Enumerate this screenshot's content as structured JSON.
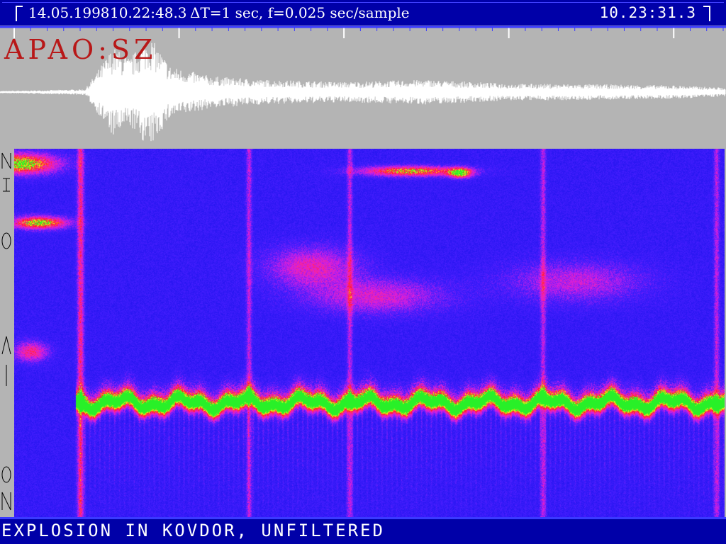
{
  "header": {
    "date": "14.05.1998",
    "start_time": "10.22:48.3",
    "params": "ΔT=1 sec, f=0.025 sec/sample",
    "end_time": "10.23:31.3"
  },
  "station_label": "APAO:SZ",
  "caption": "EXPLOSION IN KOVDOR, UNFILTERED",
  "colors": {
    "bar_blue": "#0000a8",
    "panel_gray": "#b4b4b4",
    "trace": "#ffffff",
    "station_text": "#b81818",
    "spectro_low": "#1010f0",
    "spectro_mid": "#e020e0",
    "spectro_high_red": "#ff1010",
    "spectro_peak": "#30f030"
  },
  "chart_data": {
    "type": "heatmap",
    "title": "",
    "xlabel": "",
    "ylabel": "",
    "x_range_sec": [
      0,
      43
    ],
    "tick_interval_sec": 1,
    "waveform": {
      "onset_sec": 4.3,
      "max_amplitude_sec": 8.2,
      "envelope": [
        {
          "t": 0,
          "a": 0.02
        },
        {
          "t": 4.3,
          "a": 0.05
        },
        {
          "t": 5.0,
          "a": 0.35
        },
        {
          "t": 6.0,
          "a": 0.8
        },
        {
          "t": 7.0,
          "a": 0.6
        },
        {
          "t": 8.2,
          "a": 1.0
        },
        {
          "t": 9.5,
          "a": 0.45
        },
        {
          "t": 12,
          "a": 0.28
        },
        {
          "t": 15,
          "a": 0.22
        },
        {
          "t": 20,
          "a": 0.18
        },
        {
          "t": 25,
          "a": 0.22
        },
        {
          "t": 30,
          "a": 0.15
        },
        {
          "t": 35,
          "a": 0.14
        },
        {
          "t": 40,
          "a": 0.12
        },
        {
          "t": 43,
          "a": 0.08
        }
      ]
    },
    "spectrogram": {
      "dominant_band_fraction_from_top": 0.69,
      "pulse_times_sec": [
        4.0,
        14.2,
        20.3,
        32.0,
        42.5
      ],
      "blobs": [
        {
          "t": 0.4,
          "f": 0.04,
          "w": 3.2,
          "h": 0.04,
          "level": 1.0
        },
        {
          "t": 1.5,
          "f": 0.2,
          "w": 2.5,
          "h": 0.025,
          "level": 0.95
        },
        {
          "t": 24,
          "f": 0.06,
          "w": 4.5,
          "h": 0.02,
          "level": 0.85
        },
        {
          "t": 27,
          "f": 0.065,
          "w": 1.0,
          "h": 0.02,
          "level": 0.9
        },
        {
          "t": 18,
          "f": 0.32,
          "w": 4.0,
          "h": 0.08,
          "level": 0.45
        },
        {
          "t": 22,
          "f": 0.4,
          "w": 6.0,
          "h": 0.07,
          "level": 0.4
        },
        {
          "t": 34,
          "f": 0.36,
          "w": 6.0,
          "h": 0.08,
          "level": 0.35
        },
        {
          "t": 1.0,
          "f": 0.55,
          "w": 1.5,
          "h": 0.04,
          "level": 0.55
        }
      ]
    }
  }
}
